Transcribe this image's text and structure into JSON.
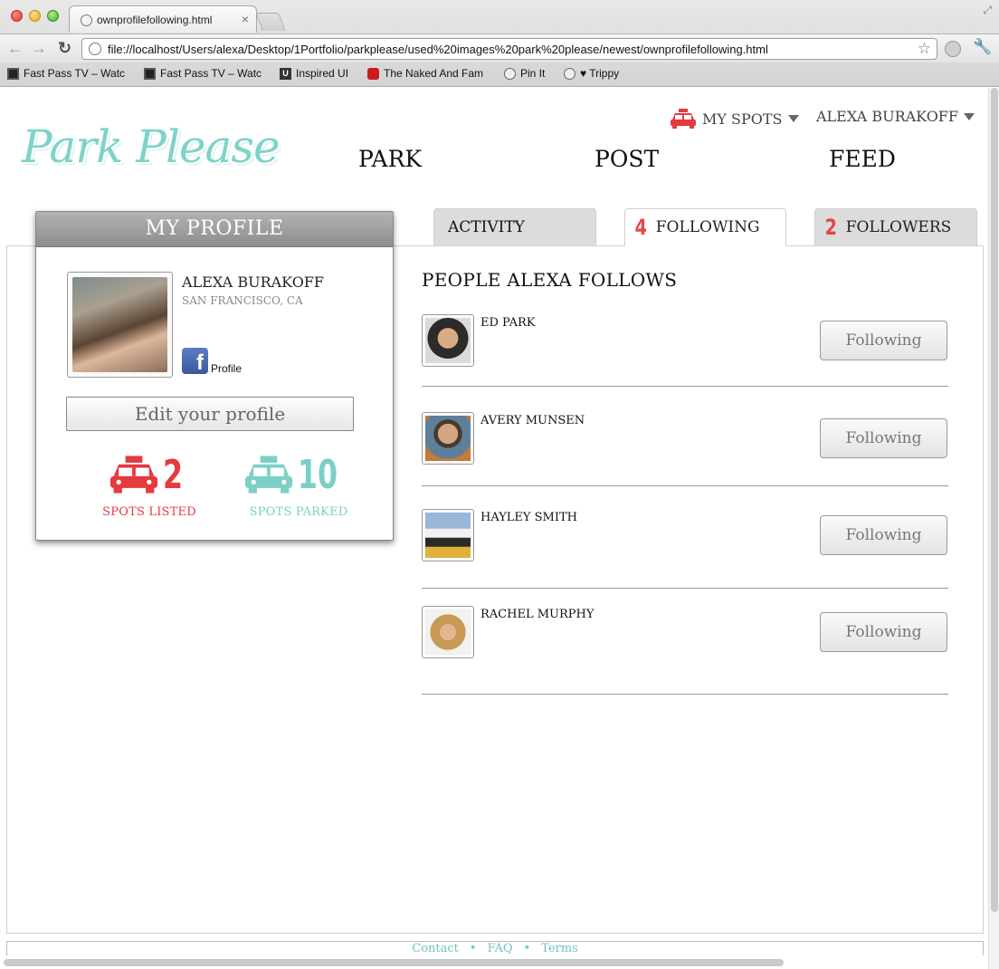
{
  "browser": {
    "tab_title": "ownprofilefollowing.html",
    "url": "file://localhost/Users/alexa/Desktop/1Portfolio/parkplease/used%20images%20park%20please/newest/ownprofilefollowing.html",
    "bookmarks": [
      {
        "label": "Fast Pass TV – Watc",
        "icon": "tv-icon"
      },
      {
        "label": "Fast Pass TV – Watc",
        "icon": "tv-icon"
      },
      {
        "label": "Inspired UI",
        "icon": "ui-icon"
      },
      {
        "label": "The Naked And Fam",
        "icon": "youtube-icon"
      },
      {
        "label": "Pin It",
        "icon": "globe-icon"
      },
      {
        "label": "♥ Trippy",
        "icon": "globe-icon"
      }
    ]
  },
  "header": {
    "logo": "Park Please",
    "my_spots": "MY SPOTS",
    "username": "ALEXA BURAKOFF",
    "nav": {
      "park": "PARK",
      "post": "POST",
      "feed": "FEED"
    }
  },
  "tabs": {
    "activity": "ACTIVITY",
    "following": {
      "count": "4",
      "label": "FOLLOWING"
    },
    "followers": {
      "count": "2",
      "label": "FOLLOWERS"
    }
  },
  "profile": {
    "header": "MY PROFILE",
    "name": "ALEXA BURAKOFF",
    "location": "SAN FRANCISCO, CA",
    "fb_label": "Profile",
    "edit_button": "Edit your profile",
    "spots_listed": {
      "count": "2",
      "label": "SPOTS LISTED",
      "color": "#e53a3f"
    },
    "spots_parked": {
      "count": "10",
      "label": "SPOTS PARKED",
      "color": "#7ad0c7"
    }
  },
  "following_list": {
    "title": "PEOPLE ALEXA FOLLOWS",
    "people": [
      {
        "name": "ED PARK",
        "button": "Following"
      },
      {
        "name": "AVERY MUNSEN",
        "button": "Following"
      },
      {
        "name": "HAYLEY SMITH",
        "button": "Following"
      },
      {
        "name": "RACHEL MURPHY",
        "button": "Following"
      }
    ]
  },
  "footer": {
    "contact": "Contact",
    "faq": "FAQ",
    "terms": "Terms"
  }
}
